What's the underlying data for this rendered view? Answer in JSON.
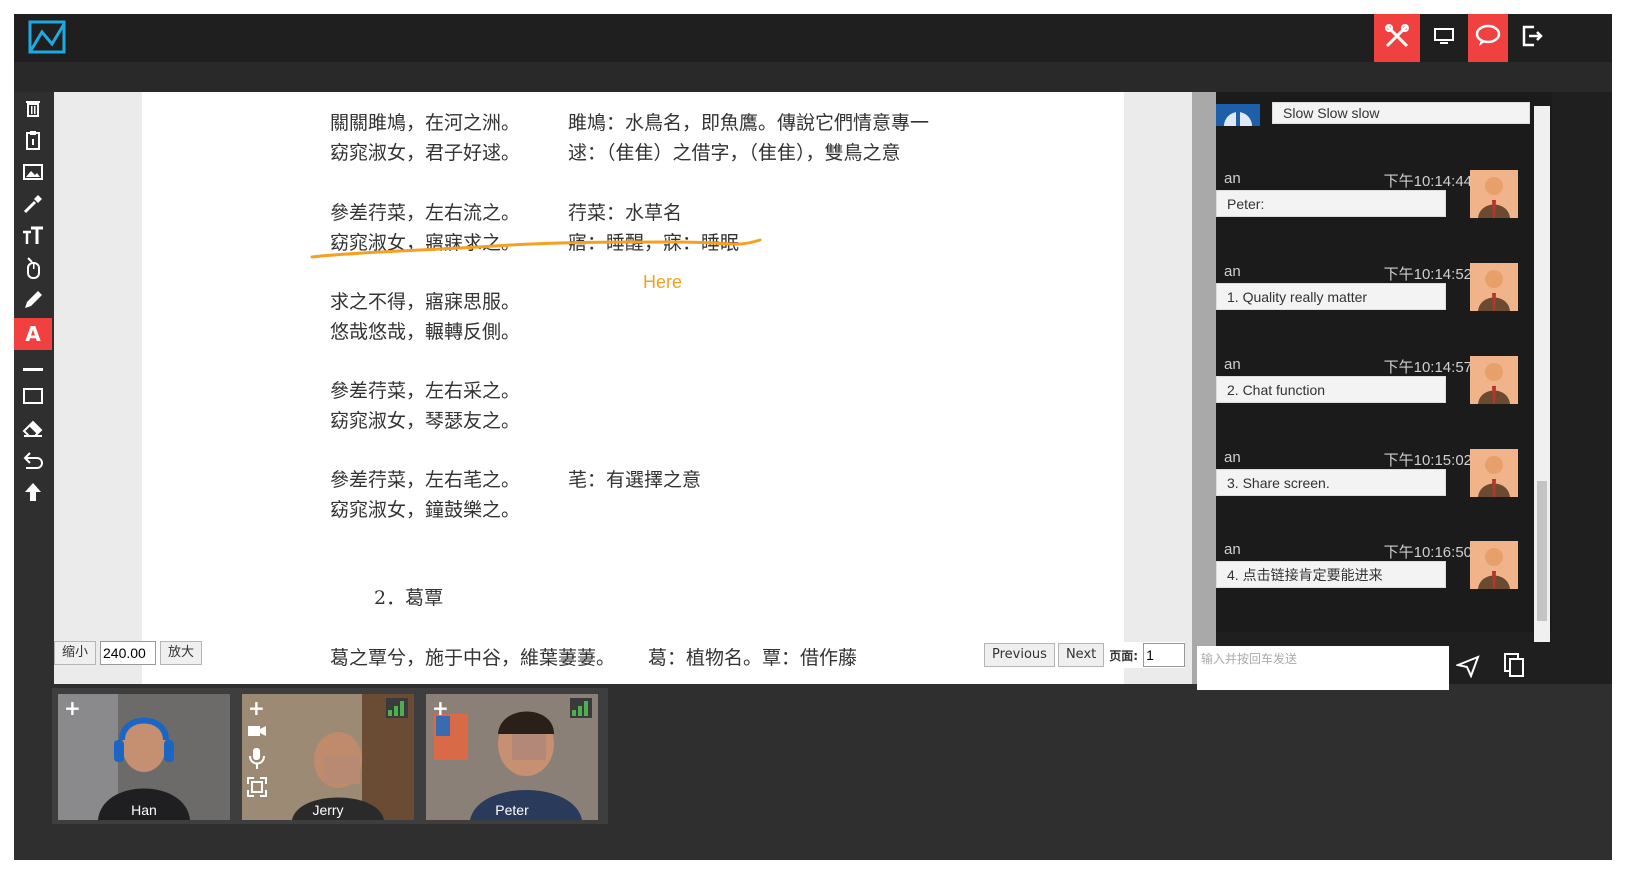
{
  "topbar": {
    "logo_icon": "app-logo-icon",
    "buttons": [
      {
        "name": "tools-button",
        "icon": "crossed-tools-icon",
        "active": true
      },
      {
        "name": "screen-button",
        "icon": "monitor-icon",
        "active": false
      },
      {
        "name": "chat-toggle-button",
        "icon": "chat-bubble-icon",
        "active": true
      },
      {
        "name": "exit-button",
        "icon": "exit-icon",
        "active": false
      }
    ]
  },
  "toolbar": {
    "tools": [
      "trash-icon",
      "clipboard-icon",
      "image-icon",
      "eyedropper-icon",
      "text-size-icon",
      "mouse-pointer-icon",
      "pen-icon",
      "text-icon",
      "line-icon",
      "rectangle-icon",
      "eraser-icon",
      "undo-icon",
      "upload-icon"
    ],
    "active_tool": "text-icon",
    "text_tool_glyph": "A"
  },
  "document": {
    "lines": [
      "關關雎鳩，在河之洲。",
      "窈窕淑女，君子好逑。",
      "參差荇菜，左右流之。",
      "窈窕淑女，寤寐求之。",
      "求之不得，寤寐思服。",
      "悠哉悠哉，輾轉反側。",
      "參差荇菜，左右采之。",
      "窈窕淑女，琴瑟友之。",
      "參差荇菜，左右芼之。",
      "窈窕淑女，鐘鼓樂之。",
      "2．葛覃",
      "葛之覃兮，施于中谷，維葉萋萋。"
    ],
    "notes": [
      "雎鳩：水鳥名，即魚鷹。傳說它們情意專一",
      "逑：（隹隹）之借字，（隹隹），雙鳥之意",
      "荇菜：水草名",
      "寤：睡醒，寐：睡眠",
      "芼：有選擇之意",
      "葛：植物名。覃：借作藤"
    ],
    "annotation_text": "Here",
    "annotation_color": "#f5a020"
  },
  "zoom": {
    "shrink_label": "缩小",
    "value": "240.00",
    "enlarge_label": "放大"
  },
  "pager": {
    "previous_label": "Previous",
    "next_label": "Next",
    "page_label": "页面:",
    "page_value": "1"
  },
  "chat": {
    "top_message": "Slow Slow slow",
    "messages": [
      {
        "name": "an",
        "time": "下午10:14:44",
        "text": "Peter:"
      },
      {
        "name": "an",
        "time": "下午10:14:52",
        "text": "1. Quality really matter"
      },
      {
        "name": "an",
        "time": "下午10:14:57",
        "text": "2. Chat function"
      },
      {
        "name": "an",
        "time": "下午10:15:02",
        "text": "3. Share screen."
      },
      {
        "name": "an",
        "time": "下午10:16:50",
        "text": "4. 点击链接肯定要能进来"
      }
    ],
    "input_placeholder": "输入并按回车发送",
    "send_icon": "send-icon",
    "copy_icon": "copy-icon"
  },
  "videos": [
    {
      "name": "Han"
    },
    {
      "name": "Jerry"
    },
    {
      "name": "Peter"
    }
  ],
  "colors": {
    "accent_red": "#f04040",
    "panel_dark": "#1f1f1f",
    "signal_green": "#4caf50"
  }
}
